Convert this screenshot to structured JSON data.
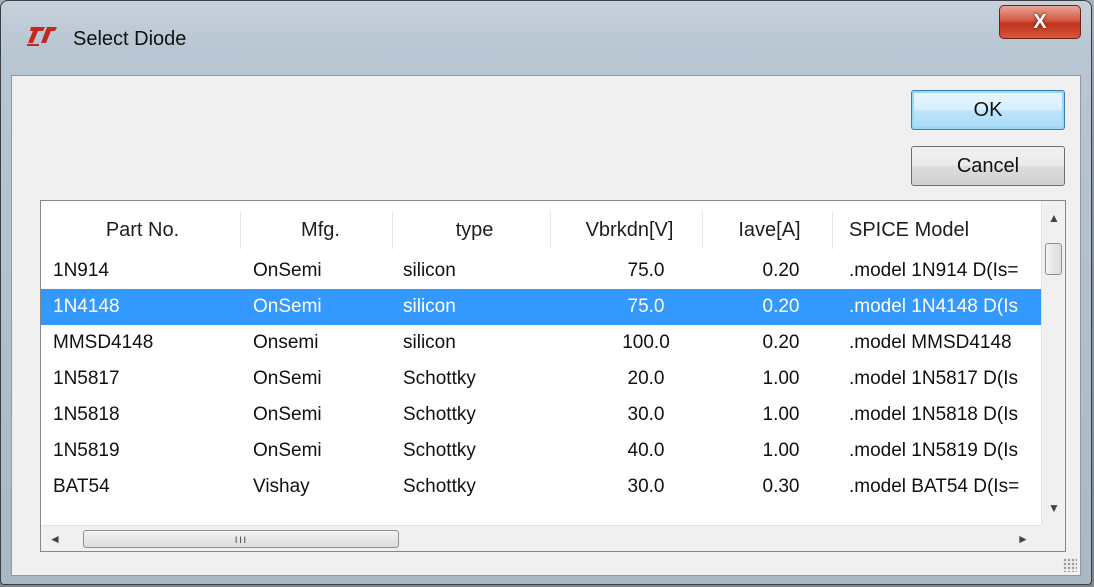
{
  "window": {
    "title": "Select Diode",
    "close_label": "X"
  },
  "buttons": {
    "ok": "OK",
    "cancel": "Cancel"
  },
  "table": {
    "columns": [
      "Part No.",
      "Mfg.",
      "type",
      "Vbrkdn[V]",
      "Iave[A]",
      "SPICE Model"
    ],
    "rows": [
      [
        "1N914",
        "OnSemi",
        "silicon",
        "75.0",
        "0.20",
        ".model 1N914 D(Is="
      ],
      [
        "1N4148",
        "OnSemi",
        "silicon",
        "75.0",
        "0.20",
        ".model 1N4148 D(Is"
      ],
      [
        "MMSD4148",
        "Onsemi",
        "silicon",
        "100.0",
        "0.20",
        ".model MMSD4148"
      ],
      [
        "1N5817",
        "OnSemi",
        "Schottky",
        "20.0",
        "1.00",
        ".model 1N5817 D(Is"
      ],
      [
        "1N5818",
        "OnSemi",
        "Schottky",
        "30.0",
        "1.00",
        ".model 1N5818 D(Is"
      ],
      [
        "1N5819",
        "OnSemi",
        "Schottky",
        "40.0",
        "1.00",
        ".model 1N5819 D(Is"
      ],
      [
        "BAT54",
        "Vishay",
        "Schottky",
        "30.0",
        "0.30",
        ".model BAT54 D(Is="
      ]
    ],
    "selected_row": 1
  },
  "icons": {
    "logo": "lt-logo-icon",
    "close": "close-icon",
    "scroll_up": "scroll-up-arrow-icon",
    "scroll_down": "scroll-down-arrow-icon",
    "scroll_left": "scroll-left-arrow-icon",
    "scroll_right": "scroll-right-arrow-icon",
    "grip": "resize-grip-icon"
  },
  "colors": {
    "selection": "#3399ff",
    "close_button": "#c0331c",
    "logo": "#c22a1e"
  }
}
